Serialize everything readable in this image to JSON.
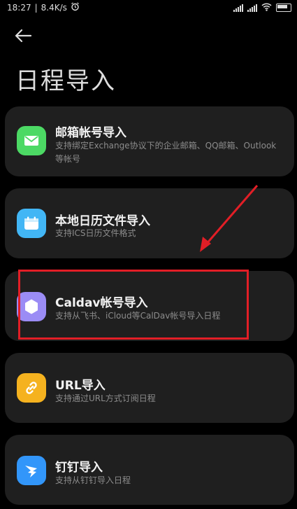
{
  "status_bar": {
    "time": "18:27",
    "speed": "8.4K/s"
  },
  "page_title": "日程导入",
  "items": [
    {
      "title": "邮箱帐号导入",
      "description": "支持绑定Exchange协议下的企业邮箱、QQ邮箱、Outlook等帐号",
      "icon": "mail-icon",
      "icon_color": "#4cd964"
    },
    {
      "title": "本地日历文件导入",
      "description": "支持ICS日历文件格式",
      "icon": "calendar-icon",
      "icon_color": "#42b6f5"
    },
    {
      "title": "Caldav帐号导入",
      "description": "支持从飞书、iCloud等CalDav帐号导入日程",
      "icon": "hexagon-icon",
      "icon_color": "#9b8cf5"
    },
    {
      "title": "URL导入",
      "description": "支持通过URL方式订阅日程",
      "icon": "link-icon",
      "icon_color": "#f5b21f"
    },
    {
      "title": "钉钉导入",
      "description": "支持从钉钉导入日程",
      "icon": "dingtalk-icon",
      "icon_color": "#3296fa"
    }
  ],
  "annotation_color": "#e21e26"
}
